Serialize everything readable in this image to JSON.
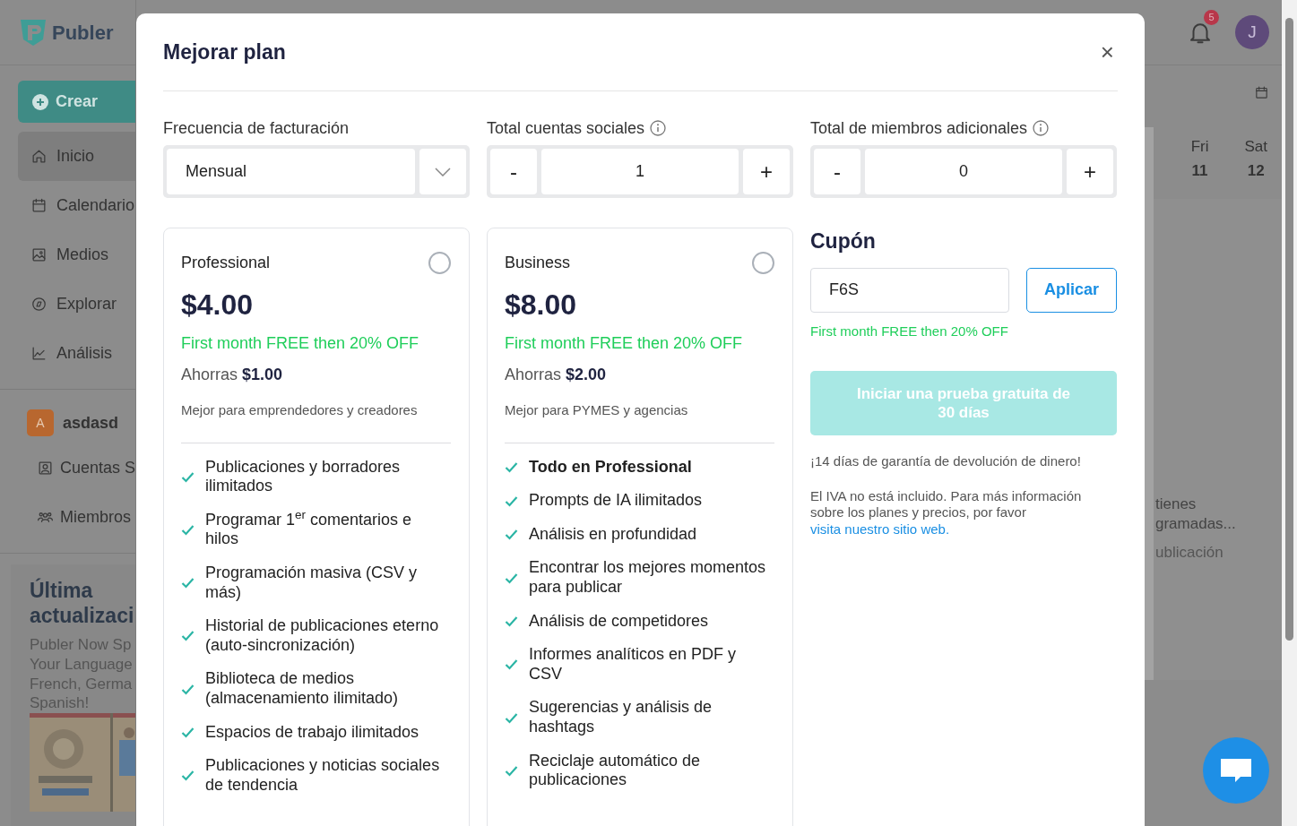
{
  "sidebar": {
    "logo": "Publer",
    "create_button": "Crear",
    "nav": [
      {
        "label": "Inicio",
        "selected": true
      },
      {
        "label": "Calendario",
        "selected": false
      },
      {
        "label": "Medios",
        "selected": false
      },
      {
        "label": "Explorar",
        "selected": false
      },
      {
        "label": "Análisis",
        "selected": false
      }
    ],
    "workspace": {
      "initial": "A",
      "name": "asdasd"
    },
    "workspace_nav": [
      "Cuentas S",
      "Miembros"
    ],
    "update": {
      "title": "Última actualizaci",
      "lines": [
        "Publer Now Sp",
        "Your Language",
        "French, Germa",
        "Spanish!"
      ],
      "image": {
        "kind": "picture"
      }
    }
  },
  "header": {
    "notification_count": "5",
    "avatar": "J"
  },
  "calendar": {
    "days": [
      {
        "day": "Fri",
        "date": "11"
      },
      {
        "day": "Sat",
        "date": "12"
      }
    ],
    "empty_lines": [
      "tienes",
      "gramadas..."
    ],
    "action": "ublicación"
  },
  "modal": {
    "title": "Mejorar plan",
    "close": "×",
    "billing": {
      "label": "Frecuencia de facturación",
      "value": "Mensual"
    },
    "steppers": [
      {
        "label": "Total cuentas sociales",
        "minus": "-",
        "value": "1",
        "plus": "+"
      },
      {
        "label": "Total de miembros adicionales",
        "minus": "-",
        "value": "0",
        "plus": "+"
      }
    ],
    "plans": [
      {
        "name": "Professional",
        "selected": false,
        "price": "$4.00",
        "promo": "First month FREE then 20% OFF",
        "savings": "Ahorras **$1.00**",
        "description": "Mejor para emprendedores y creadores",
        "features": [
          {
            "text": "Publicaciones y borradores ilimitados",
            "bold": false
          },
          {
            "text": "Programar 1$^{er}$ comentarios e hilos",
            "bold": false
          },
          {
            "text": "Programación masiva (CSV y más)",
            "bold": false
          },
          {
            "text": "Historial de publicaciones eterno (auto-sincronización)",
            "bold": false
          },
          {
            "text": "Biblioteca de medios (almacenamiento ilimitado)",
            "bold": false
          },
          {
            "text": "Espacios de trabajo ilimitados",
            "bold": false
          },
          {
            "text": "Publicaciones y noticias sociales de tendencia",
            "bold": false
          }
        ]
      },
      {
        "name": "Business",
        "selected": false,
        "price": "$8.00",
        "promo": "First month FREE then 20% OFF",
        "savings": "Ahorras **$2.00**",
        "description": "Mejor para PYMES y agencias",
        "features": [
          {
            "text": "Todo en Professional",
            "bold": true
          },
          {
            "text": "Prompts de IA ilimitados",
            "bold": false
          },
          {
            "text": "Análisis en profundidad",
            "bold": false
          },
          {
            "text": "Encontrar los mejores momentos para publicar",
            "bold": false
          },
          {
            "text": "Análisis de competidores",
            "bold": false
          },
          {
            "text": "Informes analíticos en PDF y CSV",
            "bold": false
          },
          {
            "text": "Sugerencias y análisis de hashtags",
            "bold": false
          },
          {
            "text": "Reciclaje automático de publicaciones",
            "bold": false
          }
        ]
      }
    ],
    "coupon": {
      "title": "Cupón",
      "value": "F6S",
      "apply_button": "Aplicar",
      "message": "First month FREE then 20% OFF"
    },
    "trial_button": {
      "label": "Iniciar una prueba gratuita de 30 días",
      "disabled": true
    },
    "guarantee": "¡14 días de garantía de devolución de dinero!",
    "vat_note": "El IVA no está incluido. Para más información sobre los planes y precios, por favor",
    "vat_link": "visita nuestro sitio web."
  }
}
